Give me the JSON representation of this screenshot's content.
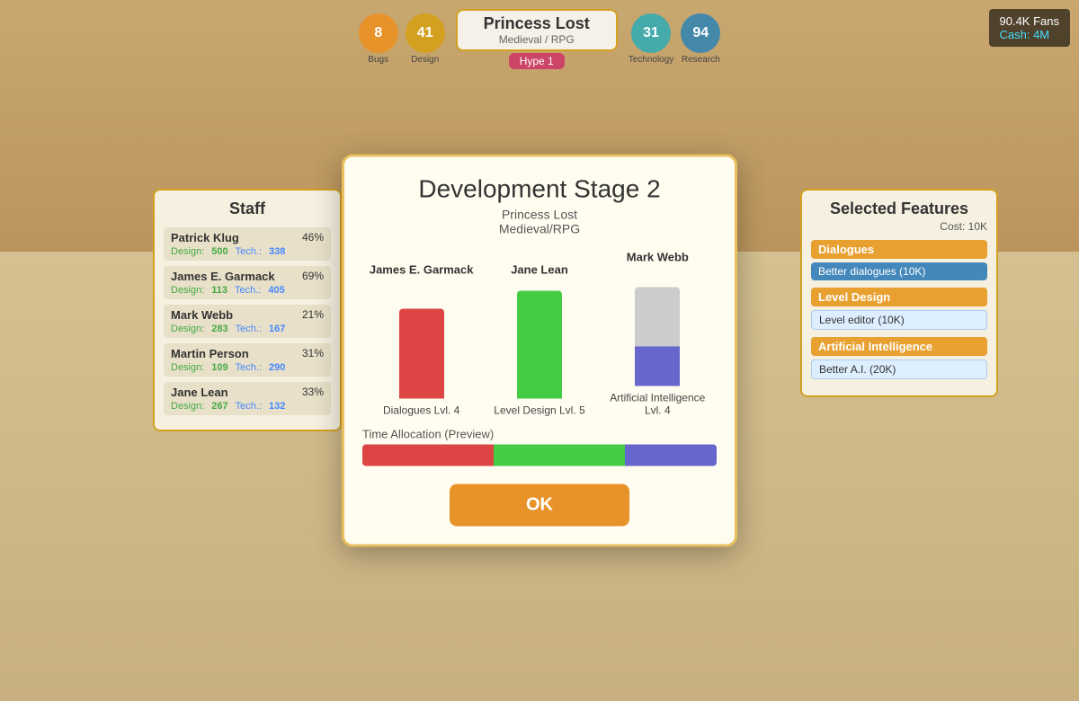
{
  "game": {
    "title": "Princess Lost",
    "genre": "Medieval / RPG",
    "bugs_count": "8",
    "bugs_label": "Bugs",
    "story_val": "41",
    "story_label": "Design",
    "tech_val": "31",
    "tech_label": "Technology",
    "research_val": "94",
    "research_label": "Research",
    "hype_label": "Hype 1",
    "fans": "90.4K Fans",
    "cash": "Cash: 4M"
  },
  "staff": {
    "title": "Staff",
    "members": [
      {
        "name": "Patrick Klug",
        "percent": "46%",
        "design_label": "Design:",
        "design_val": "500",
        "tech_label": "Tech.:",
        "tech_val": "338"
      },
      {
        "name": "James E. Garmack",
        "percent": "69%",
        "design_label": "Design:",
        "design_val": "113",
        "tech_label": "Tech.:",
        "tech_val": "405"
      },
      {
        "name": "Mark Webb",
        "percent": "21%",
        "design_label": "Design:",
        "design_val": "283",
        "tech_label": "Tech.:",
        "tech_val": "167"
      },
      {
        "name": "Martin Person",
        "percent": "31%",
        "design_label": "Design:",
        "design_val": "109",
        "tech_label": "Tech.:",
        "tech_val": "290"
      },
      {
        "name": "Jane Lean",
        "percent": "33%",
        "design_label": "Design:",
        "design_val": "267",
        "tech_label": "Tech.:",
        "tech_val": "132"
      }
    ]
  },
  "features": {
    "title": "Selected Features",
    "cost_label": "Cost: 10K",
    "categories": [
      {
        "name": "Dialogues",
        "item": "Better dialogues (10K)",
        "item_selected": true
      },
      {
        "name": "Level Design",
        "item": "Level editor (10K)",
        "item_selected": false
      },
      {
        "name": "Artificial Intelligence",
        "item": "Better A.I. (20K)",
        "item_selected": false
      }
    ]
  },
  "dialog": {
    "title": "Development Stage 2",
    "subtitle_line1": "Princess Lost",
    "subtitle_line2": "Medieval/RPG",
    "characters": [
      {
        "name": "James E. Garmack",
        "bar_color": "red",
        "skill_label": "Dialogues Lvl. 4"
      },
      {
        "name": "Jane Lean",
        "bar_color": "green",
        "skill_label": "Level Design Lvl. 5"
      },
      {
        "name": "Mark Webb",
        "bar_color": "gray-blue",
        "skill_label": "Artificial Intelligence Lvl. 4"
      }
    ],
    "time_alloc_label": "Time Allocation (Preview)",
    "ok_label": "OK"
  }
}
